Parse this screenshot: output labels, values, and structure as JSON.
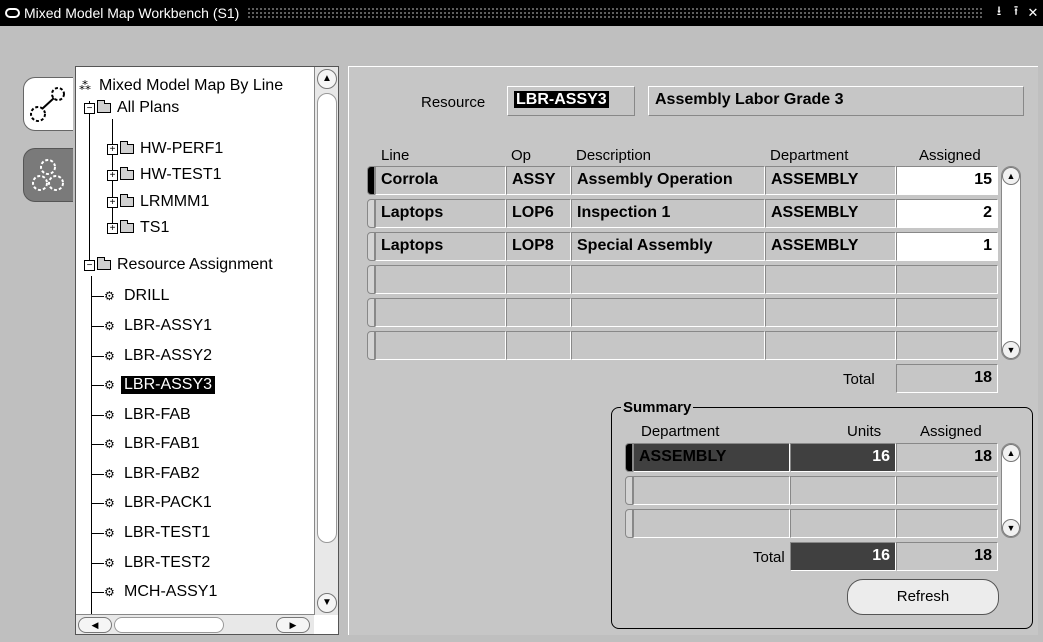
{
  "window": {
    "title": "Mixed Model Map Workbench (S1)"
  },
  "tree": {
    "root": "Mixed Model Map By Line",
    "all_plans": "All Plans",
    "plans": [
      "HW-PERF1",
      "HW-TEST1",
      "LRMMM1",
      "TS1"
    ],
    "resource_assignment": "Resource Assignment",
    "resources": [
      "DRILL",
      "LBR-ASSY1",
      "LBR-ASSY2",
      "LBR-ASSY3",
      "LBR-FAB",
      "LBR-FAB1",
      "LBR-FAB2",
      "LBR-PACK1",
      "LBR-TEST1",
      "LBR-TEST2",
      "MCH-ASSY1"
    ],
    "selected": "LBR-ASSY3"
  },
  "resource": {
    "label": "Resource",
    "code": "LBR-ASSY3",
    "description": "Assembly Labor Grade 3"
  },
  "lines": {
    "headers": {
      "line": "Line",
      "op": "Op",
      "description": "Description",
      "department": "Department",
      "assigned": "Assigned"
    },
    "rows": [
      {
        "line": "Corrola",
        "op": "ASSY",
        "description": "Assembly Operation",
        "department": "ASSEMBLY",
        "assigned": "15"
      },
      {
        "line": "Laptops",
        "op": "LOP6",
        "description": "Inspection 1",
        "department": "ASSEMBLY",
        "assigned": "2"
      },
      {
        "line": "Laptops",
        "op": "LOP8",
        "description": "Special Assembly",
        "department": "ASSEMBLY",
        "assigned": "1"
      }
    ],
    "total_label": "Total",
    "total": "18"
  },
  "summary": {
    "title": "Summary",
    "headers": {
      "department": "Department",
      "units": "Units",
      "assigned": "Assigned"
    },
    "rows": [
      {
        "department": "ASSEMBLY",
        "units": "16",
        "assigned": "18"
      }
    ],
    "total_label": "Total",
    "total_units": "16",
    "total_assigned": "18"
  },
  "buttons": {
    "refresh": "Refresh"
  }
}
